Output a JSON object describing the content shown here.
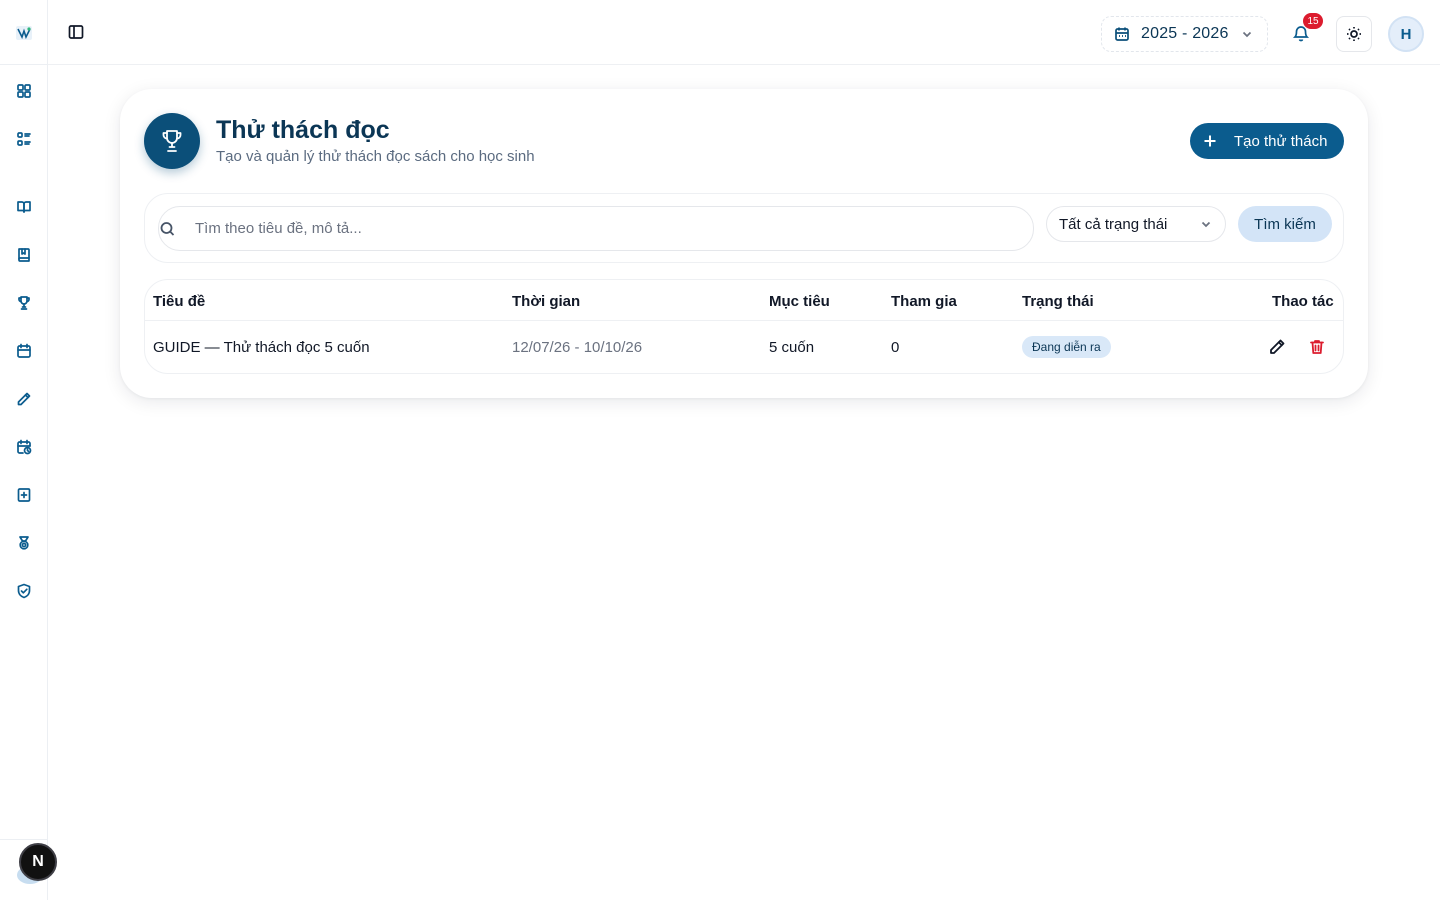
{
  "topbar": {
    "school_year": "2025 - 2026",
    "notification_count": "15",
    "avatar_initial": "H"
  },
  "sidebar": {
    "items": [
      {
        "icon": "dashboard-icon"
      },
      {
        "icon": "list-icon"
      },
      {
        "icon": "book-open-icon"
      },
      {
        "icon": "book-icon"
      },
      {
        "icon": "trophy-icon"
      },
      {
        "icon": "calendar-icon"
      },
      {
        "icon": "pen-icon"
      },
      {
        "icon": "calendar-clock-icon"
      },
      {
        "icon": "book-plus-icon"
      },
      {
        "icon": "medal-icon"
      },
      {
        "icon": "shield-check-icon"
      }
    ],
    "footer_badge": "N"
  },
  "page": {
    "title": "Thử thách đọc",
    "subtitle": "Tạo và quản lý thử thách đọc sách cho học sinh",
    "create_label": "Tạo thử thách"
  },
  "filters": {
    "search_placeholder": "Tìm theo tiêu đề, mô tả...",
    "search_value": "",
    "status_selected": "Tất cả trạng thái",
    "search_button": "Tìm kiếm"
  },
  "table": {
    "headers": [
      "Tiêu đề",
      "Thời gian",
      "Mục tiêu",
      "Tham gia",
      "Trạng thái",
      "Thao tác"
    ],
    "rows": [
      {
        "title": "GUIDE — Thử thách đọc 5 cuốn",
        "period": "12/07/26 - 10/10/26",
        "target": "5 cuốn",
        "participants": "0",
        "status": "Đang diễn ra"
      }
    ]
  },
  "colors": {
    "primary": "#0b5c8e",
    "primary_dark": "#0b4f79",
    "title_text": "#0b3655",
    "danger": "#dc1c2e",
    "pill_bg": "#d9e8f8"
  }
}
